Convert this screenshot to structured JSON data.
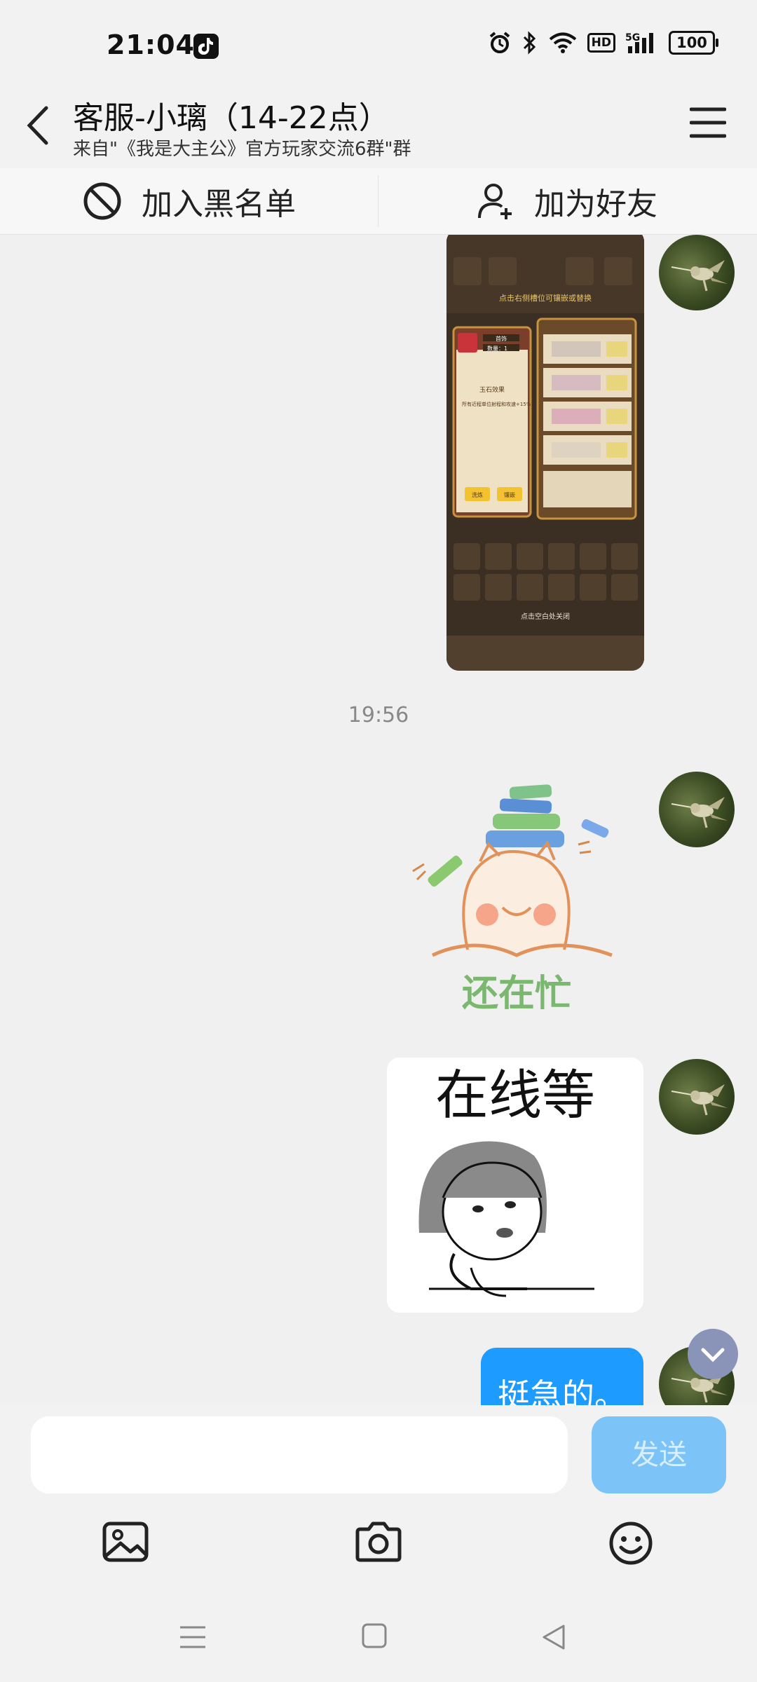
{
  "status_bar": {
    "time": "21:04",
    "battery": "100",
    "network": "5G",
    "hd": "HD"
  },
  "header": {
    "title": "客服-小璃（14-22点）",
    "subtitle": "来自\"《我是大主公》官方玩家交流6群\"群"
  },
  "actions": {
    "block_label": "加入黑名单",
    "add_friend_label": "加为好友"
  },
  "chat": {
    "timestamp": "19:56",
    "screenshot_text": {
      "top_hint": "点击右侧槽位可镶嵌或替换",
      "panel_title": "玉石效果",
      "panel_desc": "所有近程单位射程和攻速+15%",
      "tag1": "首饰",
      "tag2": "数量：1",
      "btn_a": "洗炼",
      "btn_b": "镶嵌",
      "bottom_hint": "点击空白处关闭"
    },
    "sticker1_text": "还在忙",
    "sticker2_text": "在线等",
    "last_message": "挺急的。"
  },
  "input": {
    "placeholder": "",
    "send_label": "发送"
  },
  "icons": {
    "back": "back-arrow-icon",
    "menu": "hamburger-menu-icon",
    "block": "block-icon",
    "add_friend": "add-user-icon",
    "image": "image-icon",
    "camera": "camera-icon",
    "emoji": "emoji-icon"
  },
  "colors": {
    "accent": "#1e9bff",
    "send_disabled": "#7cc4f7",
    "background": "#f0f0f0"
  }
}
